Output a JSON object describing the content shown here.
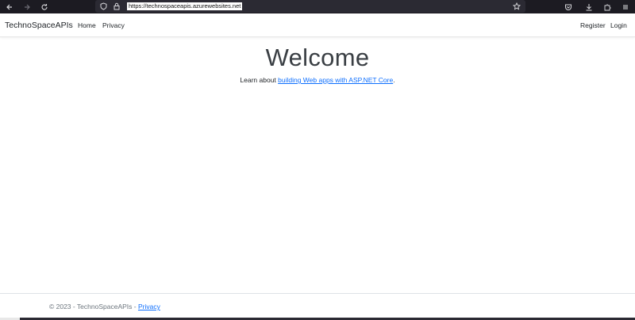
{
  "browser": {
    "url": "https://technospaceapis.azurewebsites.net",
    "icons": [
      "back-arrow-icon",
      "forward-arrow-icon",
      "reload-icon",
      "shield-icon",
      "lock-icon",
      "bookmark-star-icon",
      "pocket-icon",
      "download-icon",
      "extensions-icon",
      "menu-icon"
    ]
  },
  "navbar": {
    "brand": "TechnoSpaceAPIs",
    "links": [
      "Home",
      "Privacy"
    ],
    "right_links": [
      "Register",
      "Login"
    ]
  },
  "main": {
    "heading": "Welcome",
    "lead_prefix": "Learn about ",
    "lead_link": "building Web apps with ASP.NET Core",
    "lead_suffix": "."
  },
  "footer": {
    "text": "© 2023 - TechnoSpaceAPIs - ",
    "link": "Privacy"
  },
  "colors": {
    "link": "#0d6efd",
    "browser_chrome": "#1c1b22"
  }
}
